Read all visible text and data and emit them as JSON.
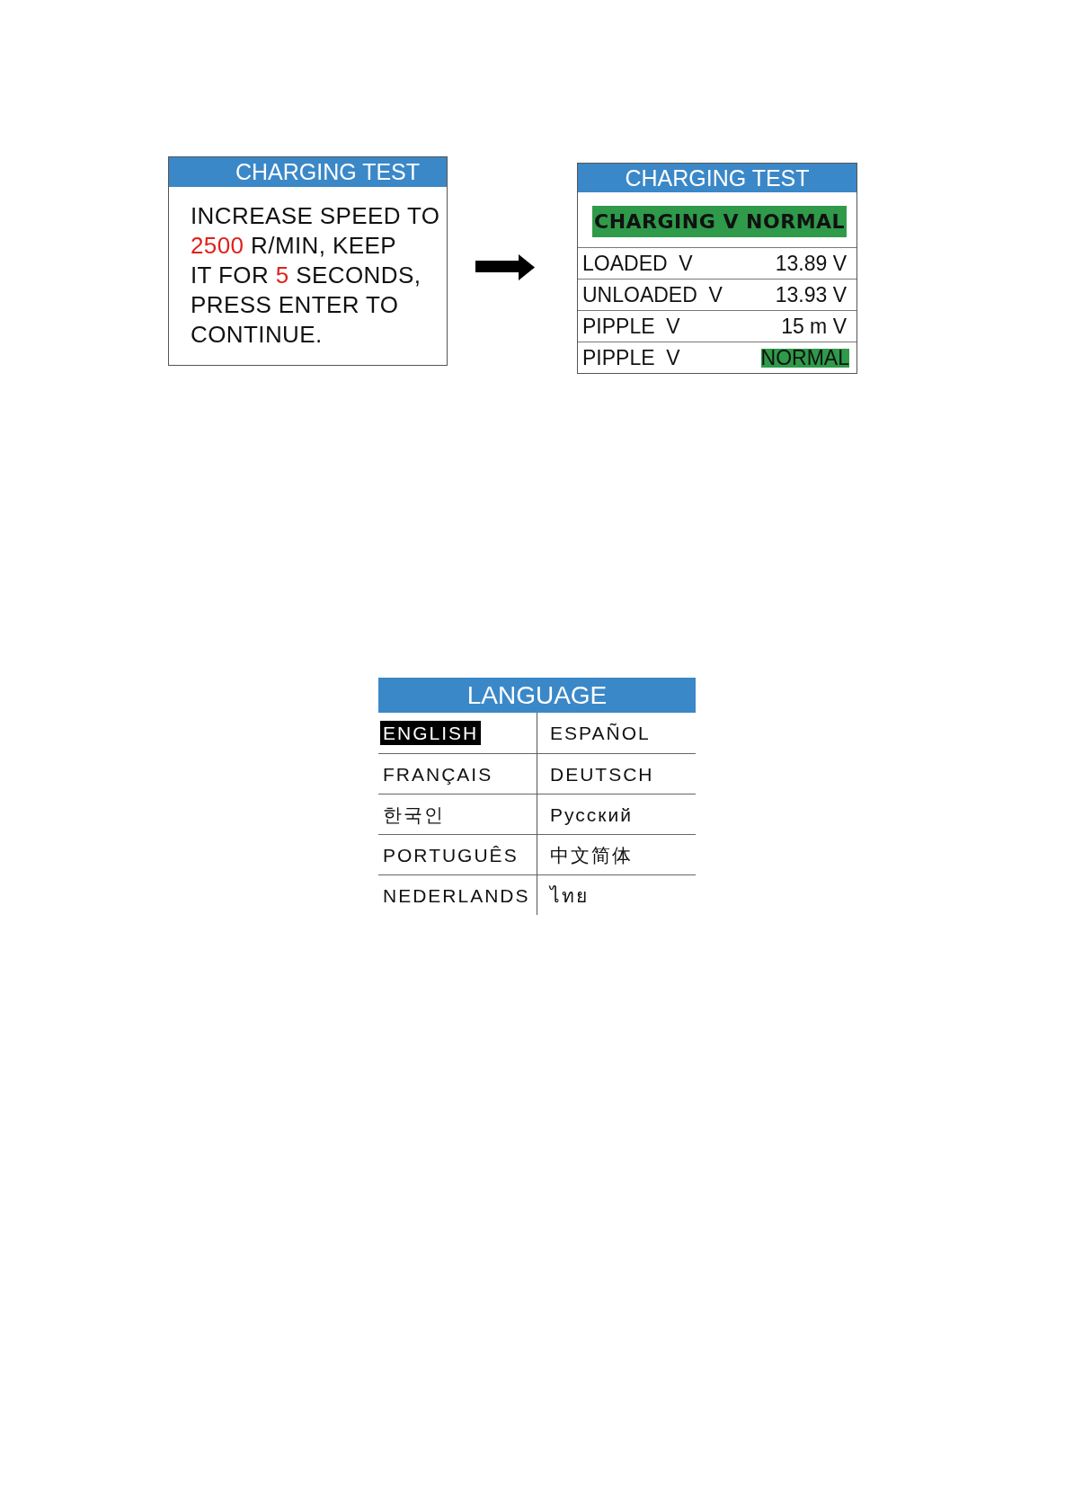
{
  "prompt_panel": {
    "title": "CHARGING TEST",
    "message": {
      "lines": [
        [
          {
            "text": "INCREASE SPEED TO",
            "highlight": false
          }
        ],
        [
          {
            "text": "2500",
            "highlight": true
          },
          {
            "text": "R/MIN, KEEP",
            "highlight": false
          }
        ],
        [
          {
            "text": "IT FOR",
            "highlight": false
          },
          {
            "text": "5",
            "highlight": true
          },
          {
            "text": "SECONDS,",
            "highlight": false
          }
        ],
        [
          {
            "text": "PRESS ENTER TO",
            "highlight": false
          }
        ],
        [
          {
            "text": "CONTINUE.",
            "highlight": false
          }
        ]
      ]
    }
  },
  "result_panel": {
    "title": "CHARGING TEST",
    "banner": "CHARGING V NORMAL",
    "rows": [
      {
        "kind": "reading",
        "label": "LOADED  V",
        "value": "13.89 V"
      },
      {
        "kind": "reading",
        "label": "UNLOADED  V",
        "value": "13.93 V"
      },
      {
        "kind": "reading",
        "label": "PIPPLE  V",
        "value": "15 m V"
      },
      {
        "kind": "status",
        "label": "PIPPLE  V",
        "value": "NORMAL"
      }
    ]
  },
  "language_menu": {
    "title": "LANGUAGE",
    "options": [
      {
        "label": "ENGLISH",
        "selected": true
      },
      {
        "label": "ESPAÑOL",
        "selected": false
      },
      {
        "label": "FRANÇAIS",
        "selected": false
      },
      {
        "label": "DEUTSCH",
        "selected": false
      },
      {
        "label": "한국인",
        "selected": false
      },
      {
        "label": "Русский",
        "selected": false
      },
      {
        "label": "PORTUGUÊS",
        "selected": false
      },
      {
        "label": "中文简体",
        "selected": false
      },
      {
        "label": "NEDERLANDS",
        "selected": false
      },
      {
        "label": "ไทย",
        "selected": false
      }
    ]
  }
}
